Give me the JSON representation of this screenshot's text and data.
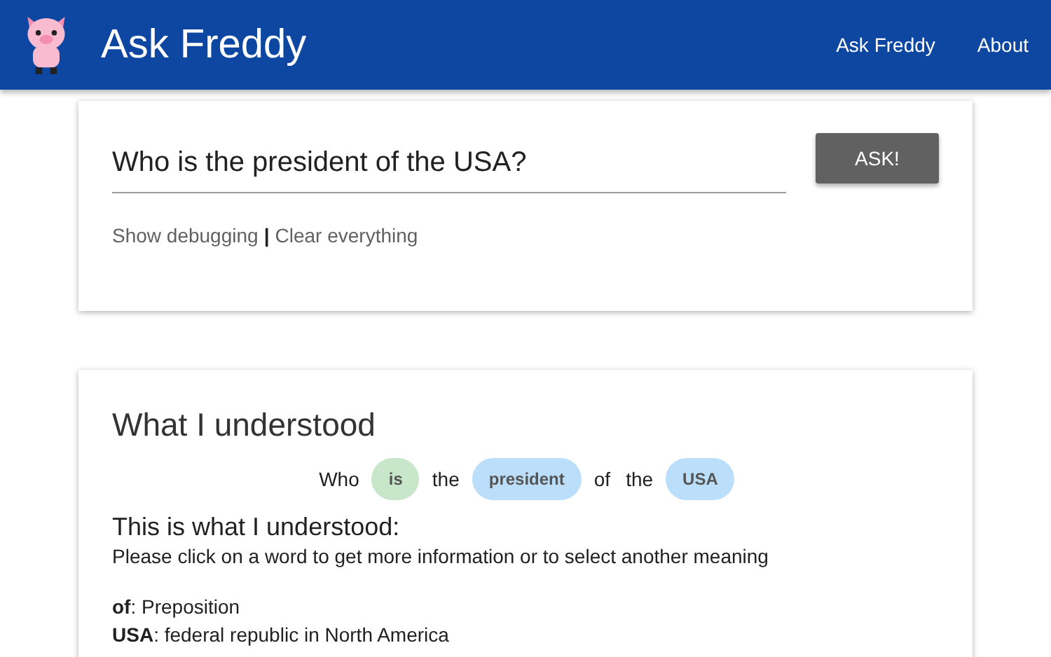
{
  "header": {
    "title": "Ask Freddy",
    "nav": [
      {
        "label": "Ask Freddy"
      },
      {
        "label": "About"
      }
    ]
  },
  "question": {
    "value": "Who is the president of the USA?",
    "button": "ASK!",
    "links": [
      {
        "label": "Show debugging"
      },
      {
        "label": "Clear everything"
      }
    ],
    "separator": "|"
  },
  "result": {
    "title": "What I understood",
    "tokens": [
      {
        "text": "Who",
        "kind": "plain"
      },
      {
        "text": "is",
        "kind": "chip",
        "color": "#c8e6c9"
      },
      {
        "text": "the",
        "kind": "plain"
      },
      {
        "text": "president",
        "kind": "chip",
        "color": "#bbdefb"
      },
      {
        "text": "of",
        "kind": "plain"
      },
      {
        "text": "the",
        "kind": "plain"
      },
      {
        "text": "USA",
        "kind": "chip",
        "color": "#bbdefb"
      }
    ],
    "subtitle": "This is what I understood:",
    "hint": "Please click on a word to get more information or to select another meaning",
    "definitions": [
      "**of**: Preposition",
      "**USA**: federal republic in North America"
    ]
  }
}
